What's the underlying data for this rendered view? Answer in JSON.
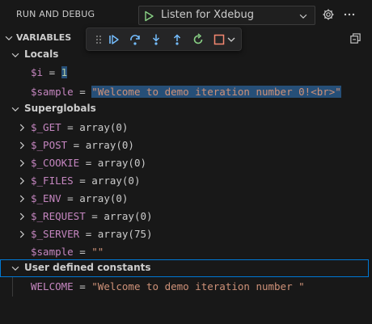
{
  "header": {
    "title": "RUN AND DEBUG",
    "config_label": "Listen for Xdebug"
  },
  "variables": {
    "title": "VARIABLES"
  },
  "toolbar": {
    "buttons": [
      "drag-handle",
      "continue",
      "step-over",
      "step-into",
      "step-out",
      "restart",
      "stop"
    ]
  },
  "locals": {
    "label": "Locals",
    "vars": [
      {
        "name": "$i",
        "eq": " = ",
        "value": "1"
      },
      {
        "name": "$sample",
        "eq": " = ",
        "value": "\"Welcome to demo iteration number 0!<br>\""
      }
    ]
  },
  "superglobals": {
    "label": "Superglobals",
    "vars": [
      {
        "name": "$_GET",
        "eq": " = ",
        "value": "array(0)"
      },
      {
        "name": "$_POST",
        "eq": " = ",
        "value": "array(0)"
      },
      {
        "name": "$_COOKIE",
        "eq": " = ",
        "value": "array(0)"
      },
      {
        "name": "$_FILES",
        "eq": " = ",
        "value": "array(0)"
      },
      {
        "name": "$_ENV",
        "eq": " = ",
        "value": "array(0)"
      },
      {
        "name": "$_REQUEST",
        "eq": " = ",
        "value": "array(0)"
      },
      {
        "name": "$_SERVER",
        "eq": " = ",
        "value": "array(75)"
      },
      {
        "name": "$sample",
        "eq": " = ",
        "value": "\"\""
      }
    ]
  },
  "constants": {
    "label": "User defined constants",
    "vars": [
      {
        "name": "WELCOME",
        "eq": " = ",
        "value": "\"Welcome to demo iteration number \""
      }
    ]
  },
  "colors": {
    "accent": "#0078d4",
    "play": "#89d185",
    "debug_blue": "#75beff",
    "stop": "#f48771"
  }
}
